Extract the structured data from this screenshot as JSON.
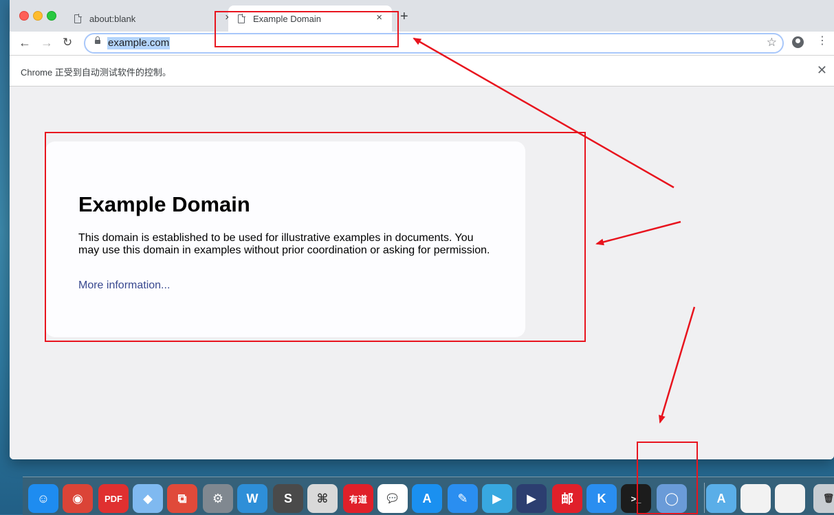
{
  "browser": {
    "tabs": [
      {
        "title": "about:blank",
        "close": "×"
      },
      {
        "title": "Example Domain",
        "close": "×"
      }
    ],
    "new_tab": "+",
    "url": "example.com",
    "infobar_text": "Chrome 正受到自动测试软件的控制。",
    "infobar_close": "✕"
  },
  "page": {
    "heading": "Example Domain",
    "paragraph": "This domain is established to be used for illustrative examples in documents. You may use this domain in examples without prior coordination or asking for permission.",
    "link": "More information..."
  },
  "dock": {
    "items": [
      {
        "name": "finder",
        "glyph": "☺",
        "color": "#1e8cf0"
      },
      {
        "name": "chrome",
        "glyph": "◉",
        "color": "#db4437"
      },
      {
        "name": "pdf-app",
        "glyph": "PDF",
        "color": "#e03030"
      },
      {
        "name": "maps-app",
        "glyph": "◆",
        "color": "#7fb9f0"
      },
      {
        "name": "vmware",
        "glyph": "⧉",
        "color": "#e04a3a"
      },
      {
        "name": "system-preferences",
        "glyph": "⚙",
        "color": "#808890"
      },
      {
        "name": "wps-writer",
        "glyph": "W",
        "color": "#2e8fd8"
      },
      {
        "name": "sublime-text",
        "glyph": "S",
        "color": "#4a4a4a"
      },
      {
        "name": "python",
        "glyph": "⌘",
        "color": "#d9d9d9"
      },
      {
        "name": "youdao",
        "glyph": "有道",
        "color": "#e0202a"
      },
      {
        "name": "wechat",
        "glyph": "💬",
        "color": "#ffffff"
      },
      {
        "name": "app-store",
        "glyph": "A",
        "color": "#1a90f0"
      },
      {
        "name": "notes-pen",
        "glyph": "✎",
        "color": "#2a8ef0"
      },
      {
        "name": "video-conf",
        "glyph": "▶",
        "color": "#38a8e0"
      },
      {
        "name": "quicktime",
        "glyph": "▶",
        "color": "#2c3e70"
      },
      {
        "name": "netease-mail",
        "glyph": "邮",
        "color": "#e0202a"
      },
      {
        "name": "k-app",
        "glyph": "K",
        "color": "#2a8ef0"
      },
      {
        "name": "terminal",
        "glyph": ">_",
        "color": "#1c1c1c"
      },
      {
        "name": "chromium",
        "glyph": "◯",
        "color": "#6a9bd8"
      },
      {
        "name": "applications-folder",
        "glyph": "A",
        "color": "#5aaee8"
      },
      {
        "name": "screenshot-1",
        "glyph": "",
        "color": "#f2f2f2"
      },
      {
        "name": "screenshot-2",
        "glyph": "",
        "color": "#f2f2f2"
      },
      {
        "name": "trash",
        "glyph": "🗑",
        "color": "#c8cdd2"
      }
    ]
  },
  "colors": {
    "annotation": "#e8141e",
    "link": "#38488f",
    "url_highlight": "#b3d4fc"
  }
}
